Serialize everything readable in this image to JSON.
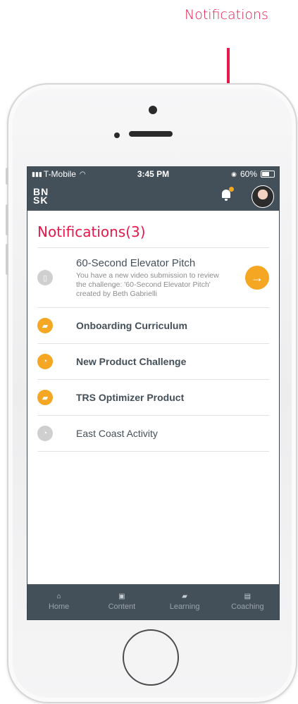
{
  "callout": {
    "label": "Notifications",
    "color": "#e5194b"
  },
  "status_bar": {
    "carrier": "T-Mobile",
    "time": "3:45 PM",
    "battery": "60%"
  },
  "app_bar": {
    "logo_top": "BN",
    "logo_bottom": "SK",
    "bell_badge_color": "#f5a623"
  },
  "notifications": {
    "title": "Notifications",
    "count": "(3)",
    "featured": {
      "title": "60-Second Elevator Pitch",
      "description": "You have a new video submission to review the challenge: '60-Second Elevator Pitch' created by Beth Gabrielli",
      "icon": "document-icon",
      "action_icon": "arrow-right-icon"
    },
    "items": [
      {
        "label": "Onboarding Curriculum",
        "icon": "graduation-cap-icon",
        "unread": true
      },
      {
        "label": "New Product Challenge",
        "icon": "whistle-icon",
        "unread": true
      },
      {
        "label": "TRS Optimizer Product",
        "icon": "graduation-cap-icon",
        "unread": true
      },
      {
        "label": "East Coast Activity",
        "icon": "whistle-icon",
        "unread": false
      }
    ]
  },
  "tabs": [
    {
      "label": "Home",
      "icon": "home-icon"
    },
    {
      "label": "Content",
      "icon": "content-icon"
    },
    {
      "label": "Learning",
      "icon": "graduation-cap-icon"
    },
    {
      "label": "Coaching",
      "icon": "clipboard-icon"
    }
  ],
  "colors": {
    "accent": "#e5194b",
    "orange": "#f5a623",
    "header": "#434f59"
  }
}
